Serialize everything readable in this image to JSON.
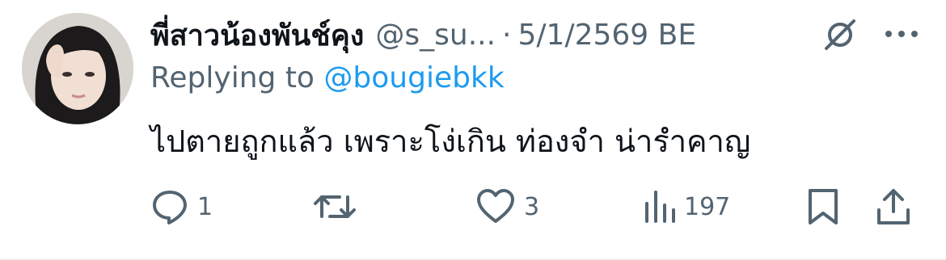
{
  "tweet": {
    "display_name": "พี่สาวน้องพันช์คุง",
    "handle": "@s_su...",
    "separator": "·",
    "date": "5/1/2569 BE",
    "replying_prefix": "Replying to",
    "replying_to": "@bougiebkk",
    "text": "ไปตายถูกแล้ว เพราะโง่เกิน ท่องจำ น่ารำคาญ"
  },
  "actions": {
    "reply_count": "1",
    "retweet_count": "",
    "like_count": "3",
    "views_count": "197"
  },
  "icons": {
    "grok": "grok-icon",
    "more": "more-icon",
    "reply": "reply-icon",
    "retweet": "retweet-icon",
    "like": "heart-icon",
    "views": "views-icon",
    "bookmark": "bookmark-icon",
    "share": "share-icon"
  },
  "colors": {
    "text": "#0f1419",
    "secondary": "#536471",
    "link": "#1d9bf0"
  }
}
